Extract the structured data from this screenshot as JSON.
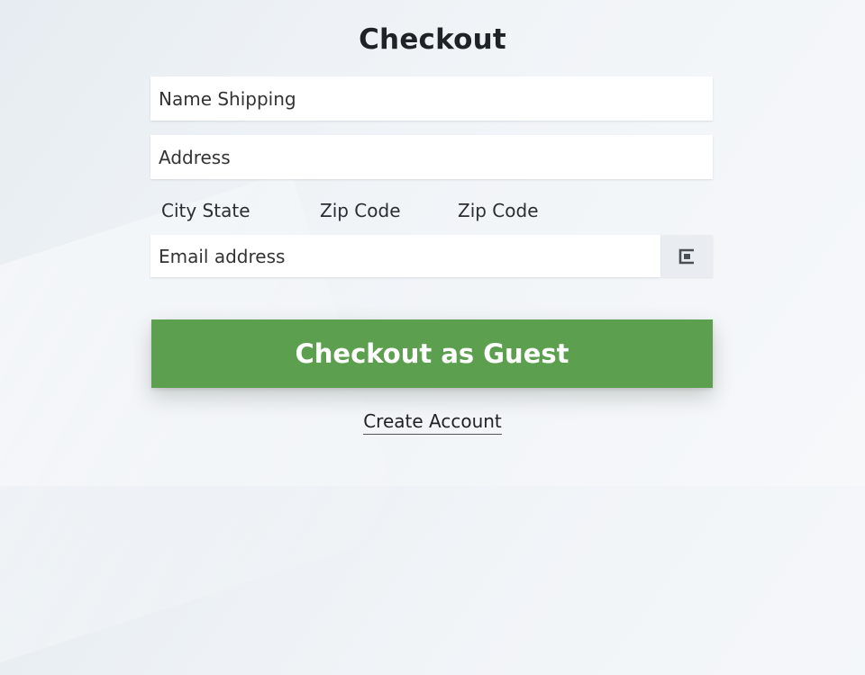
{
  "page": {
    "title": "Checkout"
  },
  "form": {
    "name_placeholder": "Name Shipping",
    "address_placeholder": "Address",
    "city_state_label": "City State",
    "zip_code_label_1": "Zip Code",
    "zip_code_label_2": "Zip Code",
    "email_placeholder": "Email address",
    "email_side_icon": "card-icon"
  },
  "actions": {
    "guest_checkout_label": "Checkout as Guest",
    "create_account_label": "Create Account"
  },
  "colors": {
    "primary_button": "#5b9f4f",
    "background": "#eef2f6",
    "text": "#222222"
  }
}
